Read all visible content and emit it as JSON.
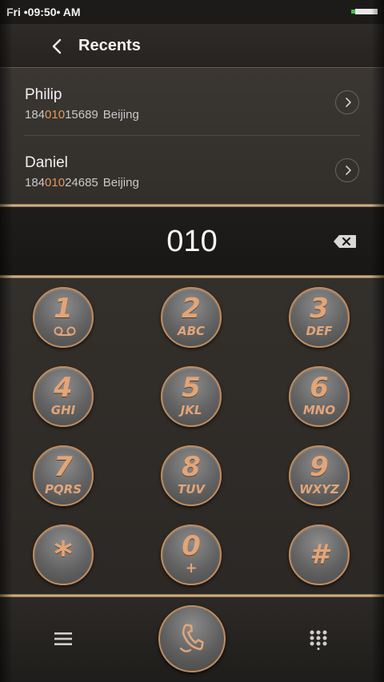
{
  "status_bar": {
    "time": "Fri •09:50• AM"
  },
  "header": {
    "title": "Recents"
  },
  "recents": [
    {
      "name": "Philip",
      "number_prefix": "184",
      "number_match": "010",
      "number_suffix": "15689",
      "location": "Beijing"
    },
    {
      "name": "Daniel",
      "number_prefix": "184",
      "number_match": "010",
      "number_suffix": "24685",
      "location": "Beijing"
    }
  ],
  "dialer": {
    "number": "010"
  },
  "keypad": [
    {
      "digit": "1",
      "letters": ""
    },
    {
      "digit": "2",
      "letters": "ABC"
    },
    {
      "digit": "3",
      "letters": "DEF"
    },
    {
      "digit": "4",
      "letters": "GHI"
    },
    {
      "digit": "5",
      "letters": "JKL"
    },
    {
      "digit": "6",
      "letters": "MNO"
    },
    {
      "digit": "7",
      "letters": "PQRS"
    },
    {
      "digit": "8",
      "letters": "TUV"
    },
    {
      "digit": "9",
      "letters": "WXYZ"
    },
    {
      "digit": "*",
      "letters": ""
    },
    {
      "digit": "0",
      "letters": "+"
    },
    {
      "digit": "#",
      "letters": ""
    }
  ],
  "icons": {
    "back": "chevron-left-icon",
    "detail": "chevron-right-icon",
    "backspace": "backspace-icon",
    "voicemail": "voicemail-icon",
    "menu": "menu-icon",
    "call": "phone-icon",
    "dialpad": "dialpad-icon"
  },
  "colors": {
    "accent_copper": "#e2a578",
    "highlight_orange": "#e39a5e",
    "battery_green": "#3fbf3f"
  }
}
